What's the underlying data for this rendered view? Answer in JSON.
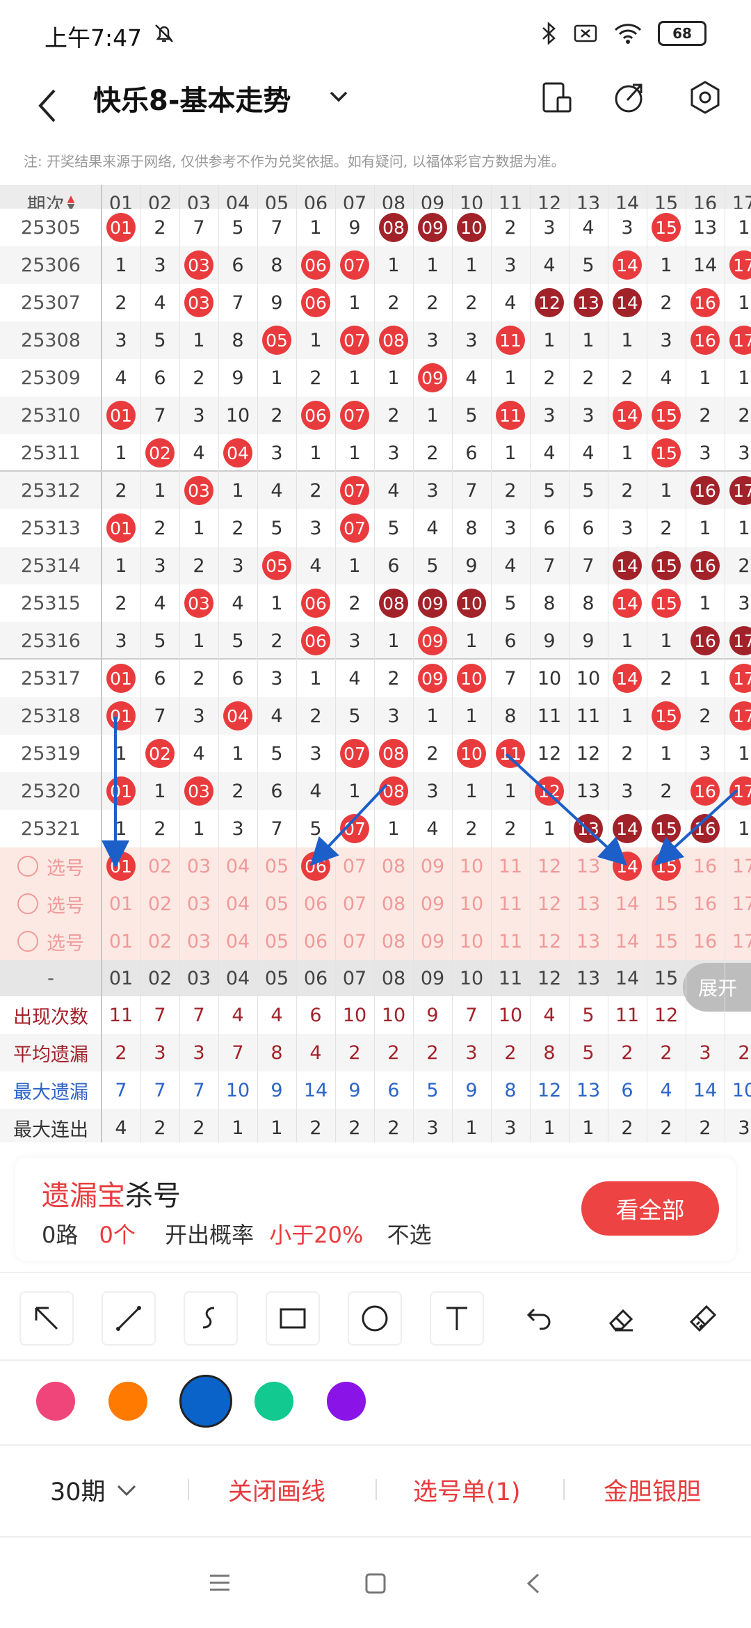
{
  "status": {
    "time": "上午7:47",
    "battery": "68"
  },
  "header": {
    "title": "快乐8-基本走势"
  },
  "notice": "注: 开奖结果来源于网络, 仅供参考不作为兑奖依据。如有疑问, 以福体彩官方数据为准。",
  "table": {
    "period_header": "期次",
    "columns": [
      "01",
      "02",
      "03",
      "04",
      "05",
      "06",
      "07",
      "08",
      "09",
      "10",
      "11",
      "12",
      "13",
      "14",
      "15",
      "16",
      "17"
    ],
    "rows": [
      {
        "period": "25305",
        "cells": [
          "01",
          "2",
          "7",
          "5",
          "7",
          "1",
          "9",
          "08",
          "09",
          "10",
          "2",
          "3",
          "4",
          "3",
          "15",
          "13",
          "1"
        ],
        "red": [
          0,
          14
        ],
        "dark": [
          7,
          8,
          9
        ]
      },
      {
        "period": "25306",
        "cells": [
          "1",
          "3",
          "03",
          "6",
          "8",
          "06",
          "07",
          "1",
          "1",
          "1",
          "3",
          "4",
          "5",
          "14",
          "1",
          "14",
          "17"
        ],
        "red": [
          2,
          5,
          6,
          13,
          16
        ],
        "dark": []
      },
      {
        "period": "25307",
        "cells": [
          "2",
          "4",
          "03",
          "7",
          "9",
          "06",
          "1",
          "2",
          "2",
          "2",
          "4",
          "12",
          "13",
          "14",
          "2",
          "16",
          "1"
        ],
        "red": [
          2,
          5,
          15
        ],
        "dark": [
          11,
          12,
          13
        ]
      },
      {
        "period": "25308",
        "cells": [
          "3",
          "5",
          "1",
          "8",
          "05",
          "1",
          "07",
          "08",
          "3",
          "3",
          "11",
          "1",
          "1",
          "1",
          "3",
          "16",
          "17"
        ],
        "red": [
          4,
          6,
          7,
          10,
          15,
          16
        ],
        "dark": []
      },
      {
        "period": "25309",
        "cells": [
          "4",
          "6",
          "2",
          "9",
          "1",
          "2",
          "1",
          "1",
          "09",
          "4",
          "1",
          "2",
          "2",
          "2",
          "4",
          "1",
          "1"
        ],
        "red": [
          8
        ],
        "dark": []
      },
      {
        "period": "25310",
        "cells": [
          "01",
          "7",
          "3",
          "10",
          "2",
          "06",
          "07",
          "2",
          "1",
          "5",
          "11",
          "3",
          "3",
          "14",
          "15",
          "2",
          "2"
        ],
        "red": [
          0,
          5,
          6,
          10,
          13,
          14
        ],
        "dark": []
      },
      {
        "period": "25311",
        "cells": [
          "1",
          "02",
          "4",
          "04",
          "3",
          "1",
          "1",
          "3",
          "2",
          "6",
          "1",
          "4",
          "4",
          "1",
          "15",
          "3",
          "3"
        ],
        "red": [
          1,
          3,
          14
        ],
        "dark": []
      },
      {
        "period": "25312",
        "cells": [
          "2",
          "1",
          "03",
          "1",
          "4",
          "2",
          "07",
          "4",
          "3",
          "7",
          "2",
          "5",
          "5",
          "2",
          "1",
          "16",
          "17"
        ],
        "red": [
          2,
          6
        ],
        "dark": [
          15,
          16
        ]
      },
      {
        "period": "25313",
        "cells": [
          "01",
          "2",
          "1",
          "2",
          "5",
          "3",
          "07",
          "5",
          "4",
          "8",
          "3",
          "6",
          "6",
          "3",
          "2",
          "1",
          "1"
        ],
        "red": [
          0,
          6
        ],
        "dark": []
      },
      {
        "period": "25314",
        "cells": [
          "1",
          "3",
          "2",
          "3",
          "05",
          "4",
          "1",
          "6",
          "5",
          "9",
          "4",
          "7",
          "7",
          "14",
          "15",
          "16",
          "2"
        ],
        "red": [
          4
        ],
        "dark": [
          13,
          14,
          15
        ]
      },
      {
        "period": "25315",
        "cells": [
          "2",
          "4",
          "03",
          "4",
          "1",
          "06",
          "2",
          "08",
          "09",
          "10",
          "5",
          "8",
          "8",
          "14",
          "15",
          "1",
          "3"
        ],
        "red": [
          2,
          5,
          13,
          14
        ],
        "dark": [
          7,
          8,
          9
        ]
      },
      {
        "period": "25316",
        "cells": [
          "3",
          "5",
          "1",
          "5",
          "2",
          "06",
          "3",
          "1",
          "09",
          "1",
          "6",
          "9",
          "9",
          "1",
          "1",
          "16",
          "17"
        ],
        "red": [
          5,
          8
        ],
        "dark": [
          15,
          16
        ]
      },
      {
        "period": "25317",
        "cells": [
          "01",
          "6",
          "2",
          "6",
          "3",
          "1",
          "4",
          "2",
          "09",
          "10",
          "7",
          "10",
          "10",
          "14",
          "2",
          "1",
          "17"
        ],
        "red": [
          0,
          8,
          9,
          13,
          16
        ],
        "dark": []
      },
      {
        "period": "25318",
        "cells": [
          "01",
          "7",
          "3",
          "04",
          "4",
          "2",
          "5",
          "3",
          "1",
          "1",
          "8",
          "11",
          "11",
          "1",
          "15",
          "2",
          "17"
        ],
        "red": [
          0,
          3,
          14,
          16
        ],
        "dark": []
      },
      {
        "period": "25319",
        "cells": [
          "1",
          "02",
          "4",
          "1",
          "5",
          "3",
          "07",
          "08",
          "2",
          "10",
          "11",
          "12",
          "12",
          "2",
          "1",
          "3",
          "1"
        ],
        "red": [
          1,
          6,
          7,
          9,
          10
        ],
        "dark": []
      },
      {
        "period": "25320",
        "cells": [
          "01",
          "1",
          "03",
          "2",
          "6",
          "4",
          "1",
          "08",
          "3",
          "1",
          "1",
          "12",
          "13",
          "3",
          "2",
          "16",
          "17"
        ],
        "red": [
          0,
          2,
          7,
          11,
          15,
          16
        ],
        "dark": []
      },
      {
        "period": "25321",
        "cells": [
          "1",
          "2",
          "1",
          "3",
          "7",
          "5",
          "07",
          "1",
          "4",
          "2",
          "2",
          "1",
          "13",
          "14",
          "15",
          "16",
          "1"
        ],
        "red": [
          6
        ],
        "dark": [
          12,
          13,
          14,
          15
        ]
      }
    ],
    "pick_label": "选号",
    "pick_rows": [
      {
        "selected": [
          0,
          5,
          13,
          14
        ]
      },
      {
        "selected": []
      },
      {
        "selected": []
      }
    ],
    "stats_dash": "-",
    "expand_label": "展开",
    "stats": [
      {
        "label": "出现次数",
        "values": [
          "11",
          "7",
          "7",
          "4",
          "4",
          "6",
          "10",
          "10",
          "9",
          "7",
          "10",
          "4",
          "5",
          "11",
          "12",
          "",
          ""
        ],
        "color": "#a2222a"
      },
      {
        "label": "平均遗漏",
        "values": [
          "2",
          "3",
          "3",
          "7",
          "8",
          "4",
          "2",
          "2",
          "2",
          "3",
          "2",
          "8",
          "5",
          "2",
          "2",
          "3",
          "2"
        ],
        "color": "#a2222a"
      },
      {
        "label": "最大遗漏",
        "values": [
          "7",
          "7",
          "7",
          "10",
          "9",
          "14",
          "9",
          "6",
          "5",
          "9",
          "8",
          "12",
          "13",
          "6",
          "4",
          "14",
          "10"
        ],
        "color": "#2d64c8"
      },
      {
        "label": "最大连出",
        "values": [
          "4",
          "2",
          "2",
          "1",
          "1",
          "2",
          "2",
          "2",
          "3",
          "1",
          "3",
          "1",
          "1",
          "2",
          "2",
          "2",
          "3"
        ],
        "color": "#333"
      }
    ]
  },
  "card": {
    "brand_red": "遗漏宝",
    "brand_black": "杀号",
    "route": "0路",
    "count": "0个",
    "prob_label": "开出概率",
    "prob_value": "小于20%",
    "action": "不选",
    "button": "看全部"
  },
  "toolbar": {
    "tools": [
      "arrow-tool-icon",
      "line-tool-icon",
      "curve-tool-icon",
      "rectangle-tool-icon",
      "circle-tool-icon",
      "text-tool-icon",
      "undo-icon",
      "eraser-icon",
      "clear-icon"
    ]
  },
  "palette": {
    "colors": [
      "#f0457a",
      "#ff7a00",
      "#0a63c9",
      "#12c98f",
      "#8a14e8"
    ],
    "selected": 2
  },
  "bottom": {
    "period": "30期",
    "close_lines": "关闭画线",
    "pick_list": "选号单(1)",
    "gold_silver": "金胆银胆"
  },
  "annotation_color": "#1c5fc9"
}
